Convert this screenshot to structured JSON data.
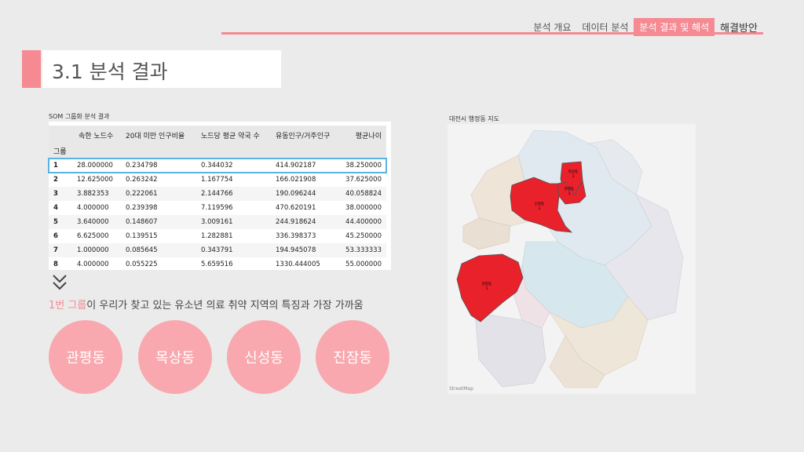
{
  "nav": {
    "tabs": [
      "분석 개요",
      "데이터 분석",
      "분석 결과 및 해석",
      "해결방안"
    ],
    "active_index": 2
  },
  "section": {
    "title": "3.1 분석 결과"
  },
  "table": {
    "caption": "SOM 그룹화 분석 결과",
    "index_label": "그룹",
    "columns": [
      "속한 노드수",
      "20대 미만 인구비율",
      "노드당 평균 약국 수",
      "유동인구/거주인구",
      "평균나이"
    ],
    "rows": [
      [
        "1",
        "28.000000",
        "0.234798",
        "0.344032",
        "414.902187",
        "38.250000"
      ],
      [
        "2",
        "12.625000",
        "0.263242",
        "1.167754",
        "166.021908",
        "37.625000"
      ],
      [
        "3",
        "3.882353",
        "0.222061",
        "2.144766",
        "190.096244",
        "40.058824"
      ],
      [
        "4",
        "4.000000",
        "0.239398",
        "7.119596",
        "470.620191",
        "38.000000"
      ],
      [
        "5",
        "3.640000",
        "0.148607",
        "3.009161",
        "244.918624",
        "44.400000"
      ],
      [
        "6",
        "6.625000",
        "0.139515",
        "1.282881",
        "336.398373",
        "45.250000"
      ],
      [
        "7",
        "1.000000",
        "0.085645",
        "0.343791",
        "194.945078",
        "53.333333"
      ],
      [
        "8",
        "4.000000",
        "0.055225",
        "5.659516",
        "1330.444005",
        "55.000000"
      ]
    ],
    "selected_row": 0
  },
  "finding": {
    "highlight": "1번 그룹",
    "rest": "이 우리가 찾고 있는 유소년 의료 취약 지역의 특징과 가장 가까움"
  },
  "dongs": [
    "관평동",
    "목상동",
    "신성동",
    "진잠동"
  ],
  "map": {
    "caption": "대전시 행정동 지도",
    "attribution": "StreetMap",
    "highlight_color": "#e8212b",
    "regions": [
      {
        "name": "목상동",
        "value": "1"
      },
      {
        "name": "관평동",
        "value": "1"
      },
      {
        "name": "신성동",
        "value": "1"
      },
      {
        "name": "진잠동",
        "value": "1"
      }
    ]
  },
  "colors": {
    "accent": "#f58a93",
    "circle": "#f8a8ae",
    "selection": "#5ab4e2"
  }
}
